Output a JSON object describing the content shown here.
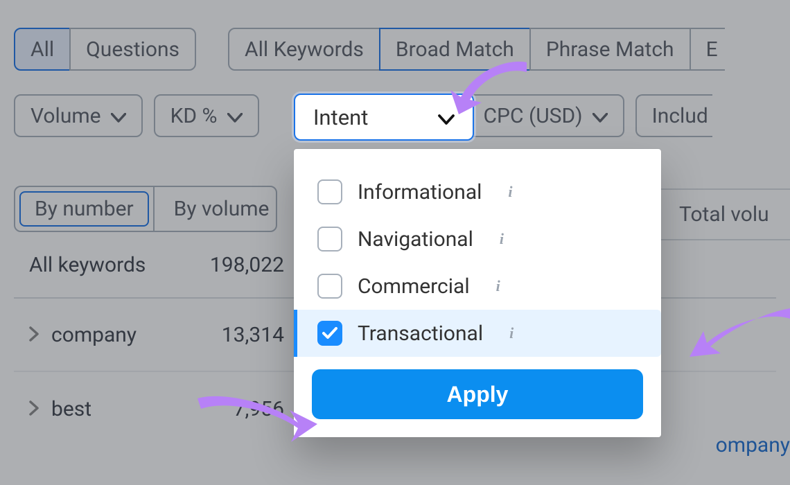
{
  "top_tabs": {
    "group1": [
      "All",
      "Questions"
    ],
    "group2": [
      "All Keywords",
      "Broad Match",
      "Phrase Match",
      "E"
    ],
    "active_g1": "All",
    "active_g2": "Broad Match"
  },
  "filters": {
    "volume": "Volume",
    "kd": "KD %",
    "intent": "Intent",
    "cpc": "CPC (USD)",
    "include_partial": "Includ"
  },
  "view_tabs": {
    "items": [
      "By number",
      "By volume"
    ],
    "selected": "By number"
  },
  "right_header_fragment": "Total volu",
  "table": {
    "header_label": "All keywords",
    "header_value": "198,022",
    "rows": [
      {
        "keyword": "company",
        "count": "13,314"
      },
      {
        "keyword": "best",
        "count": "7,956"
      }
    ]
  },
  "link_fragment": "ompany",
  "intent_dropdown": {
    "options": [
      {
        "label": "Informational",
        "checked": false
      },
      {
        "label": "Navigational",
        "checked": false
      },
      {
        "label": "Commercial",
        "checked": false
      },
      {
        "label": "Transactional",
        "checked": true
      }
    ],
    "apply": "Apply"
  }
}
